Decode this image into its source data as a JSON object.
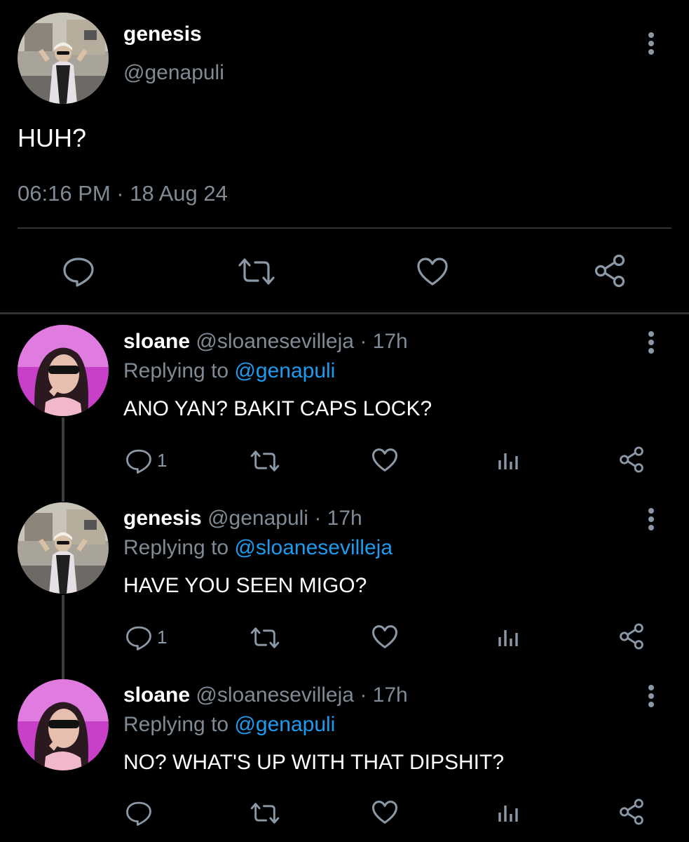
{
  "main_tweet": {
    "author_name": "genesis",
    "author_handle": "@genapuli",
    "text": "HUH?",
    "timestamp": "06:16 PM · 18 Aug 24"
  },
  "replies": [
    {
      "author_name": "sloane",
      "author_handle": "@sloanesevilleja",
      "age": "· 17h",
      "replying_prefix": "Replying to ",
      "replying_to": "@genapuli",
      "text": "ANO YAN? BAKIT CAPS LOCK?",
      "reply_count": "1"
    },
    {
      "author_name": "genesis",
      "author_handle": "@genapuli",
      "age": "· 17h",
      "replying_prefix": "Replying to ",
      "replying_to": "@sloanesevilleja",
      "text": "HAVE YOU SEEN MIGO?",
      "reply_count": "1"
    },
    {
      "author_name": "sloane",
      "author_handle": "@sloanesevilleja",
      "age": "· 17h",
      "replying_prefix": "Replying to ",
      "replying_to": "@genapuli",
      "text": "NO? WHAT'S UP WITH THAT DIPSHIT?",
      "reply_count": ""
    }
  ],
  "icons": {
    "reply": "reply-icon",
    "retweet": "retweet-icon",
    "like": "heart-icon",
    "views": "analytics-icon",
    "share": "share-icon",
    "more": "more-options-icon"
  },
  "colors": {
    "background": "#000000",
    "text": "#e7e9ea",
    "secondary": "#7f8a94",
    "link": "#1d9bf0",
    "divider": "#2f3336"
  }
}
